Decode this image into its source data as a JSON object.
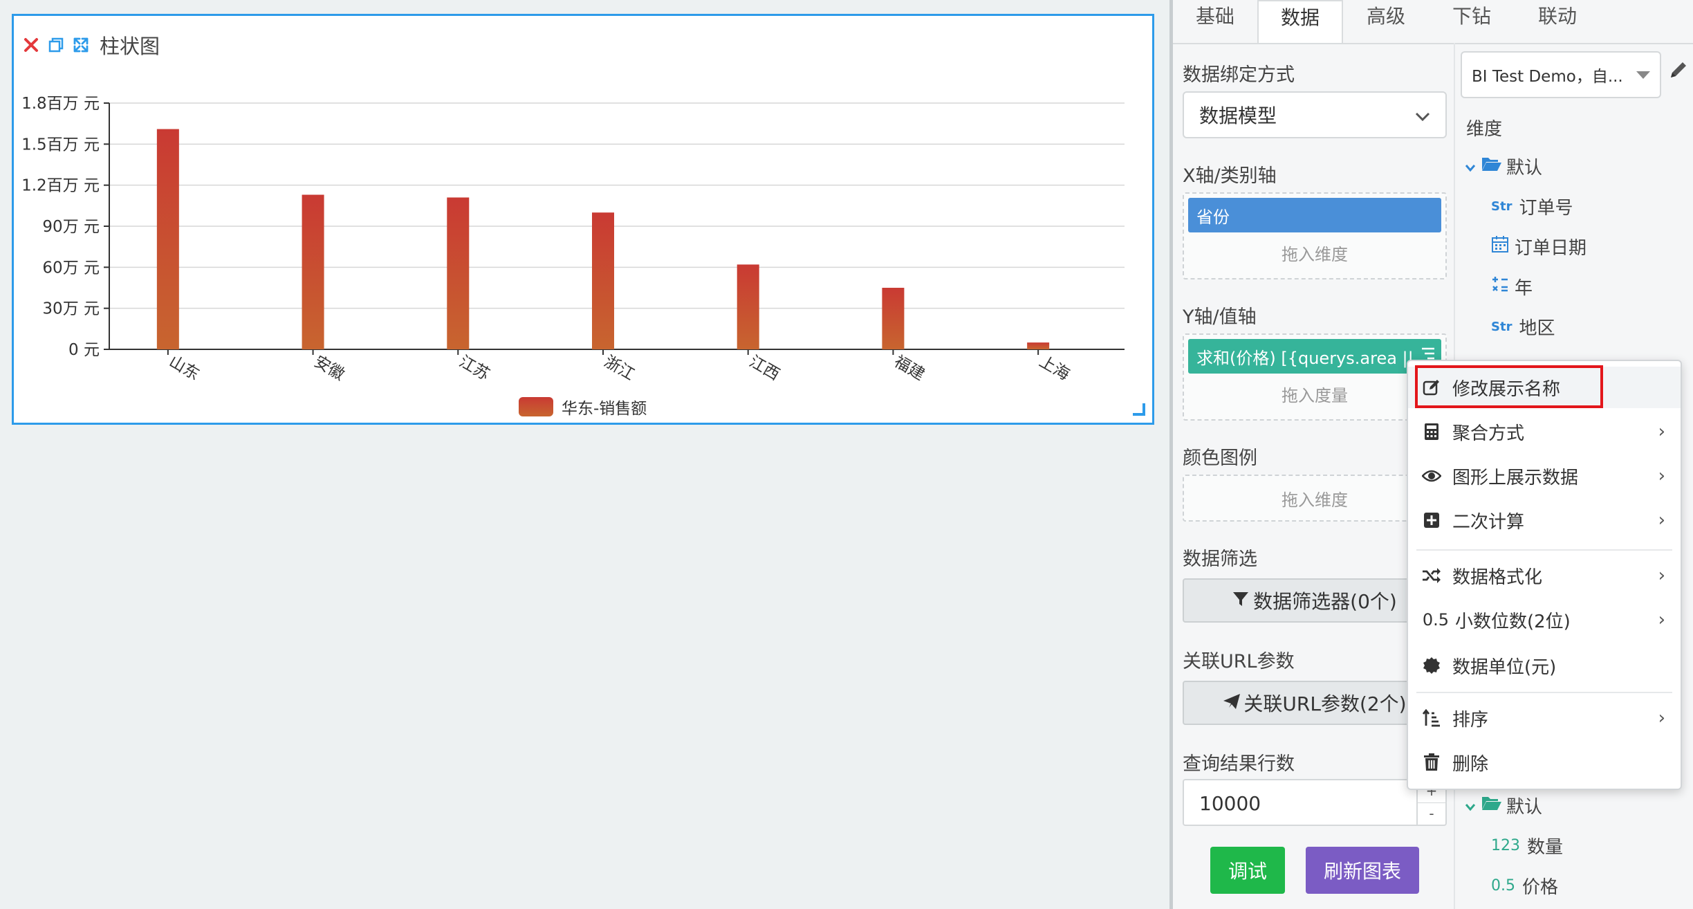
{
  "widget": {
    "title": "柱状图",
    "close_icon": "close-icon",
    "copy_icon": "copy-icon",
    "expand_icon": "expand-icon"
  },
  "chart_data": {
    "type": "bar",
    "categories": [
      "山东",
      "安徽",
      "江苏",
      "浙江",
      "江西",
      "福建",
      "上海"
    ],
    "series": [
      {
        "name": "华东-销售额",
        "values": [
          1610000,
          1130000,
          1110000,
          1000000,
          620000,
          450000,
          50000
        ]
      }
    ],
    "y_ticks": [
      "0 元",
      "30万 元",
      "60万 元",
      "90万 元",
      "1.2百万 元",
      "1.5百万 元",
      "1.8百万 元"
    ],
    "ylim": [
      0,
      1800000
    ],
    "grid": true,
    "legend_position": "bottom-center",
    "colors": {
      "bar_top": "#c93a33",
      "bar_bottom": "#c8652f"
    }
  },
  "tabs": [
    "基础",
    "数据",
    "高级",
    "下钻",
    "联动"
  ],
  "active_tab": "数据",
  "config": {
    "binding_label": "数据绑定方式",
    "binding_value": "数据模型",
    "x_axis_label": "X轴/类别轴",
    "x_chip": "省份",
    "x_hint": "拖入维度",
    "y_axis_label": "Y轴/值轴",
    "y_chip": "求和(价格) [{querys.area ||...",
    "y_hint": "拖入度量",
    "color_legend_label": "颜色图例",
    "color_hint": "拖入维度",
    "filter_label": "数据筛选",
    "filter_button": "数据筛选器(0个)",
    "url_label": "关联URL参数",
    "url_button": "关联URL参数(2个)",
    "rows_label": "查询结果行数",
    "rows_value": "10000",
    "stepper_plus": "+",
    "stepper_minus": "-",
    "debug_button": "调试",
    "refresh_button": "刷新图表"
  },
  "datasource": {
    "name": "BI Test Demo，自...",
    "dimensions_label": "维度",
    "folder_default": "默认",
    "fields": [
      {
        "type": "Str",
        "label": "订单号"
      },
      {
        "type": "date",
        "label": "订单日期"
      },
      {
        "type": "calc",
        "label": "年"
      },
      {
        "type": "Str",
        "label": "地区"
      }
    ],
    "measures_folder": "默认",
    "measures": [
      {
        "type": "123",
        "label": "数量"
      },
      {
        "type": "0.5",
        "label": "价格"
      }
    ]
  },
  "context_menu": {
    "items": [
      {
        "label": "修改展示名称",
        "icon": "edit-icon",
        "arrow": ""
      },
      {
        "label": "聚合方式",
        "icon": "calculator-icon",
        "arrow": "›"
      },
      {
        "label": "图形上展示数据",
        "icon": "eye-icon",
        "arrow": "›"
      },
      {
        "label": "二次计算",
        "icon": "plus-square-icon",
        "arrow": "›"
      },
      {
        "label": "数据格式化",
        "icon": "shuffle-icon",
        "arrow": "›"
      },
      {
        "label": "小数位数(2位)",
        "icon": "decimal-icon",
        "icon_text": "0.5",
        "arrow": "›"
      },
      {
        "label": "数据单位(元)",
        "icon": "certificate-icon",
        "arrow": ""
      },
      {
        "label": "排序",
        "icon": "sort-icon",
        "arrow": "›"
      },
      {
        "label": "删除",
        "icon": "trash-icon",
        "arrow": ""
      }
    ],
    "highlight_color": "#e3161b"
  },
  "colors": {
    "accent": "#2d9bea",
    "x_chip": "#4a8fd8",
    "y_chip": "#36b49a",
    "debug_button": "#1fb84a",
    "refresh_button": "#7b5cc4"
  }
}
